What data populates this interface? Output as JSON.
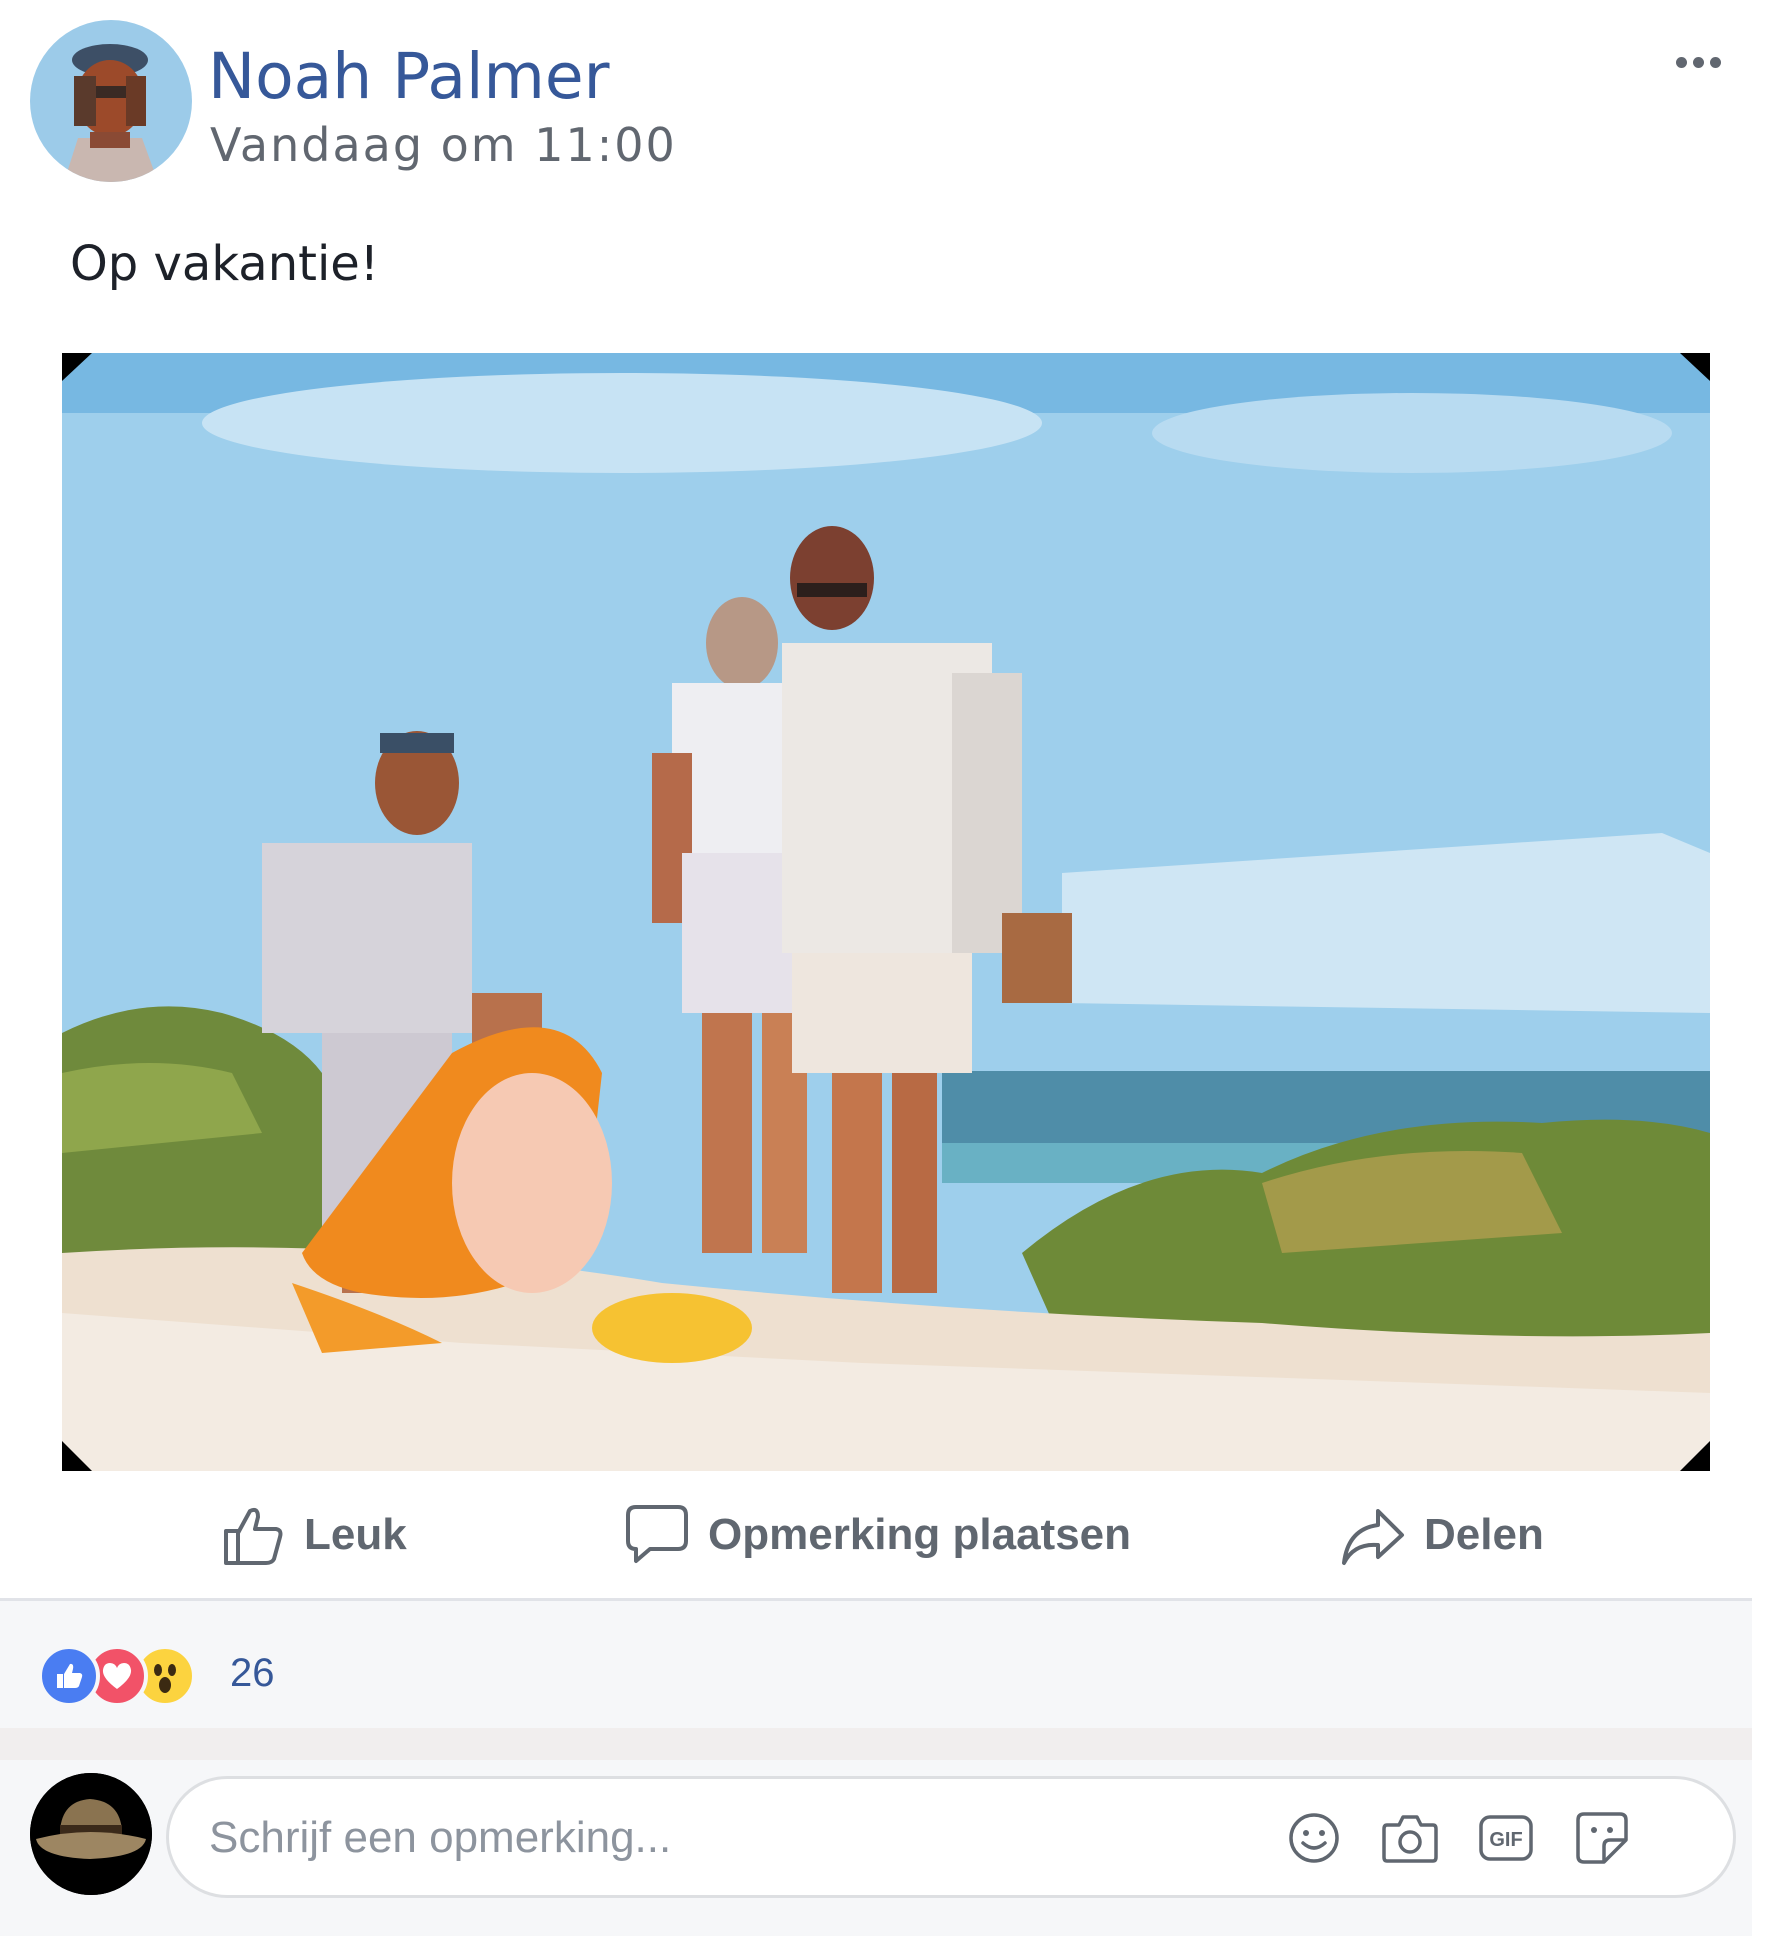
{
  "post": {
    "author": "Noah Palmer",
    "timestamp": "Vandaag om 11:00",
    "message": "Op vakantie!",
    "menu_icon": "more-horizontal-icon"
  },
  "actions": {
    "like_label": "Leuk",
    "comment_label": "Opmerking plaatsen",
    "share_label": "Delen",
    "like_icon": "thumbs-up-icon",
    "comment_icon": "speech-bubble-icon",
    "share_icon": "share-arrow-icon"
  },
  "reactions": {
    "types": [
      "like",
      "love",
      "wow"
    ],
    "count": "26"
  },
  "comment": {
    "placeholder": "Schrijf een opmerking...",
    "icons": [
      "emoji-icon",
      "camera-icon",
      "gif-icon",
      "sticker-icon"
    ]
  },
  "colors": {
    "link": "#365899",
    "secondary_text": "#616770",
    "action_text": "#606770",
    "like": "#4a7df2",
    "love": "#f25268",
    "wow": "#fcd33f"
  }
}
